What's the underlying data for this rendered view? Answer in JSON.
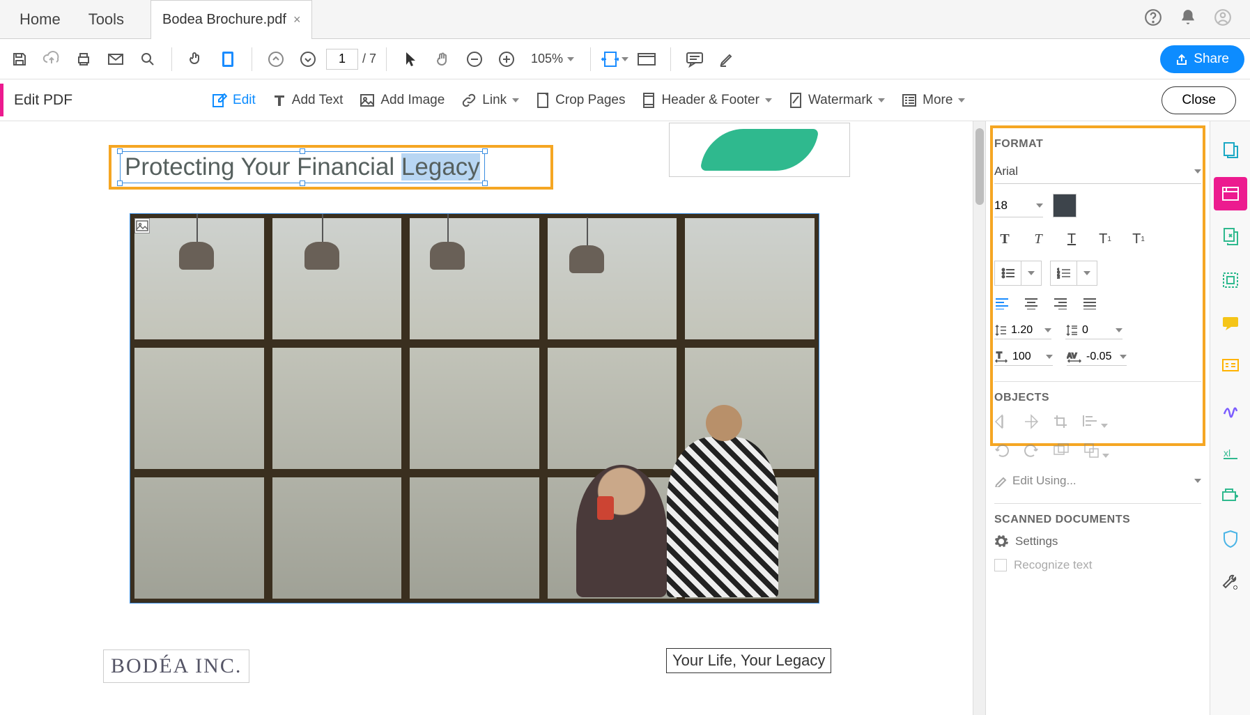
{
  "tabs": {
    "home": "Home",
    "tools": "Tools",
    "doc": "Bodea Brochure.pdf"
  },
  "toolbar": {
    "page_current": "1",
    "page_total": "/ 7",
    "zoom": "105%",
    "share": "Share"
  },
  "editbar": {
    "title": "Edit PDF",
    "edit": "Edit",
    "add_text": "Add Text",
    "add_image": "Add Image",
    "link": "Link",
    "crop": "Crop Pages",
    "header_footer": "Header & Footer",
    "watermark": "Watermark",
    "more": "More",
    "close": "Close"
  },
  "doc": {
    "heading_pre": "Protecting Your Financial ",
    "heading_sel": "Legacy",
    "logo": "BODÉA INC.",
    "tagline": "Your Life, Your Legacy"
  },
  "panel": {
    "format": "FORMAT",
    "font": "Arial",
    "size": "18",
    "line_height": "1.20",
    "para_spacing": "0",
    "hscale": "100",
    "tracking": "-0.05",
    "objects": "OBJECTS",
    "edit_using": "Edit Using...",
    "scanned": "SCANNED DOCUMENTS",
    "settings": "Settings",
    "recognize": "Recognize text"
  }
}
